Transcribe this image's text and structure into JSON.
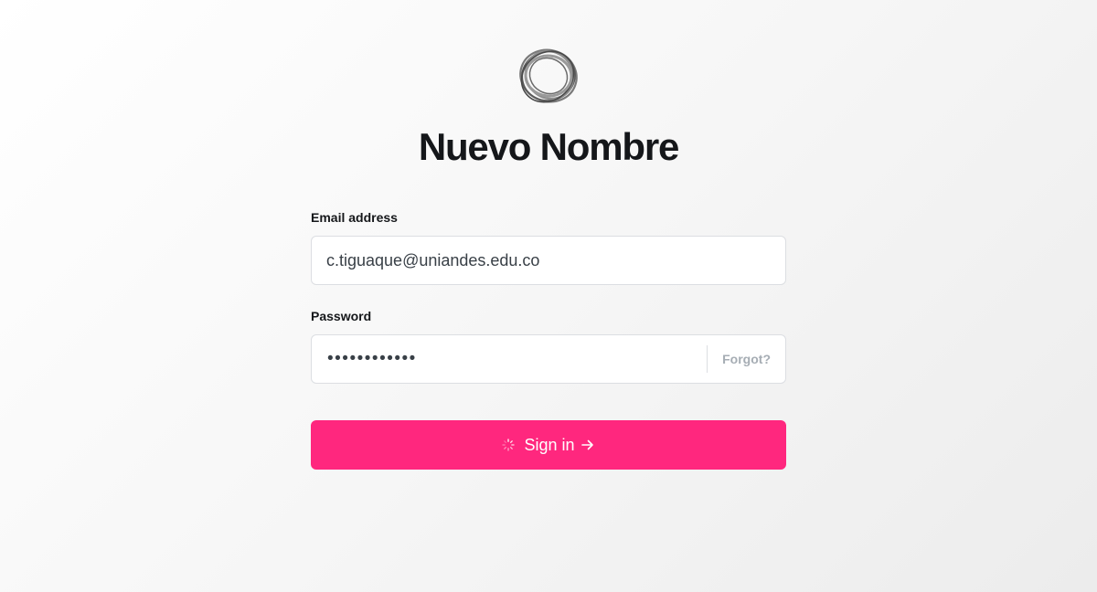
{
  "site": {
    "logo_icon": "ring-logo-icon",
    "title": "Nuevo Nombre"
  },
  "form": {
    "email": {
      "label": "Email address",
      "value": "c.tiguaque@uniandes.edu.co"
    },
    "password": {
      "label": "Password",
      "masked_value": "••••••••••••",
      "forgot_label": "Forgot?"
    },
    "submit": {
      "label": "Sign in",
      "loading_icon": "spinner-icon",
      "arrow_icon": "arrow-right-icon"
    }
  },
  "colors": {
    "accent": "#ff277e",
    "title": "#15171a",
    "muted": "#a6adb4"
  }
}
